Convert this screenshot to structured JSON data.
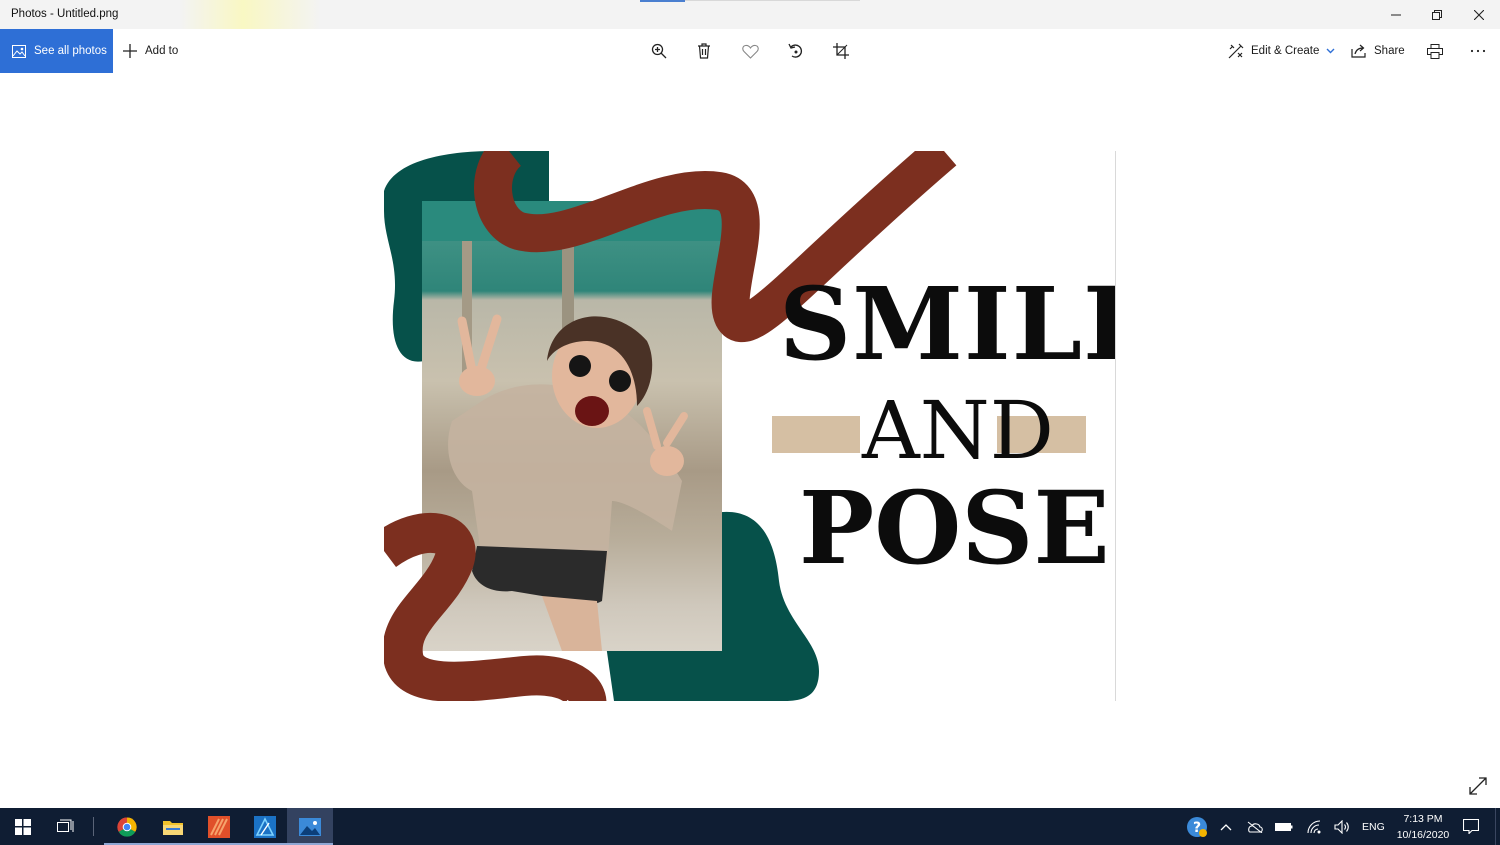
{
  "window": {
    "title": "Photos - Untitled.png",
    "controls": [
      "minimize",
      "restore",
      "close"
    ]
  },
  "toolbar": {
    "see_all_label": "See all photos",
    "add_to_label": "Add to",
    "center_icons": [
      "zoom-in-icon",
      "delete-icon",
      "favorite-heart-icon",
      "rotate-icon",
      "crop-icon"
    ],
    "edit_create_label": "Edit & Create",
    "share_label": "Share",
    "print_icon": "printer-icon",
    "more_icon": "more-ellipsis-icon"
  },
  "image": {
    "headline_1": "SMILE",
    "headline_2": "AND",
    "headline_3": "POSE",
    "colors": {
      "teal": "#06514a",
      "brown": "#7c2f1f",
      "tan": "#d5bfa3",
      "text": "#0c0c0c"
    }
  },
  "colors": {
    "accent": "#2e6fd6",
    "taskbar": "#0f1d33",
    "taskbar_active": "#334260"
  },
  "taskbar": {
    "apps": [
      "chrome",
      "file-explorer",
      "office-app",
      "affinity-designer",
      "photos"
    ],
    "active_app": "photos",
    "language": "ENG",
    "time": "7:13 PM",
    "date": "10/16/2020"
  }
}
